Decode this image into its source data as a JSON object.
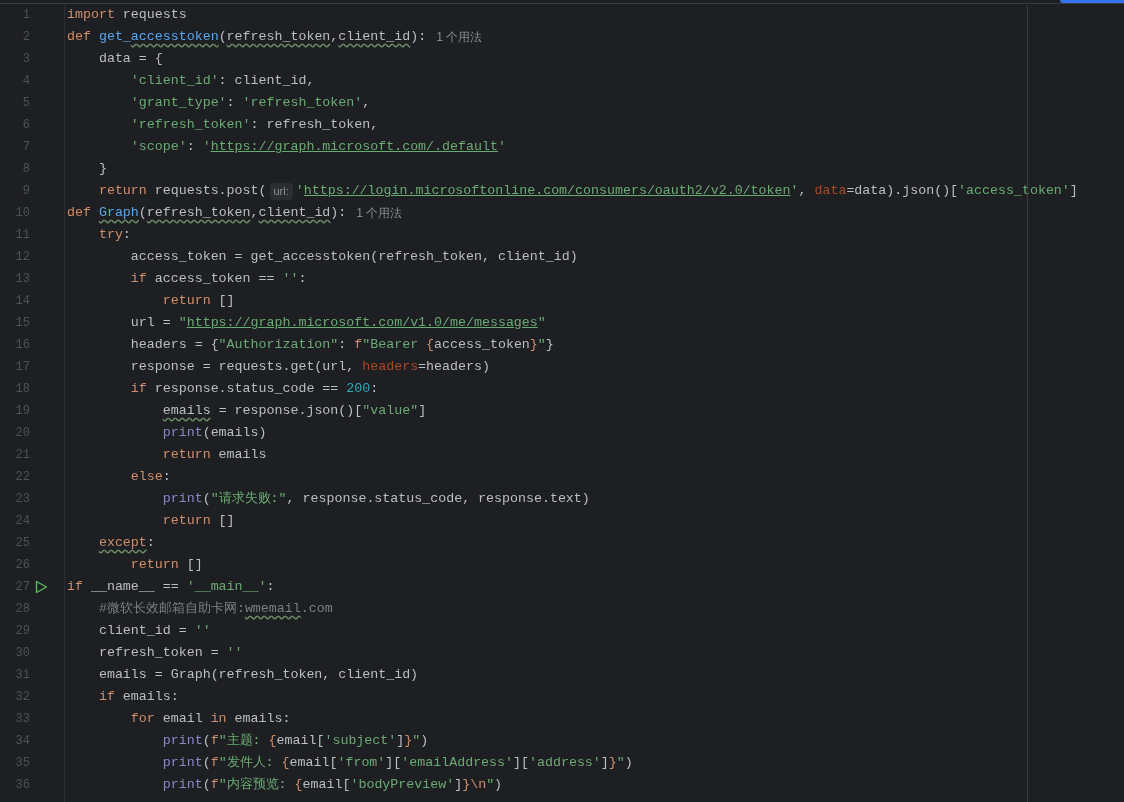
{
  "editor": {
    "lines": [
      {
        "number": "1",
        "run_marker": false,
        "tokens": [
          {
            "kind": "keyword",
            "text": "import"
          },
          {
            "kind": "plain",
            "text": " requests"
          }
        ]
      },
      {
        "number": "2",
        "run_marker": false,
        "tokens": [
          {
            "kind": "keyword",
            "text": "def "
          },
          {
            "kind": "function",
            "text": "get_"
          },
          {
            "kind": "function",
            "text": "accesstoken",
            "squiggle": true
          },
          {
            "kind": "plain",
            "text": "("
          },
          {
            "kind": "plain",
            "text": "refresh_token",
            "squiggle": true
          },
          {
            "kind": "plain",
            "text": ","
          },
          {
            "kind": "plain",
            "text": "client_id",
            "squiggle": true
          },
          {
            "kind": "plain",
            "text": "):"
          },
          {
            "kind": "usages",
            "text": "1 个用法"
          }
        ]
      },
      {
        "number": "3",
        "run_marker": false,
        "tokens": [
          {
            "kind": "plain",
            "text": "    data = {"
          }
        ]
      },
      {
        "number": "4",
        "run_marker": false,
        "tokens": [
          {
            "kind": "string",
            "text": "        'client_id'"
          },
          {
            "kind": "plain",
            "text": ": client_id,"
          }
        ]
      },
      {
        "number": "5",
        "run_marker": false,
        "tokens": [
          {
            "kind": "string",
            "text": "        'grant_type'"
          },
          {
            "kind": "plain",
            "text": ": "
          },
          {
            "kind": "string",
            "text": "'refresh_token'"
          },
          {
            "kind": "plain",
            "text": ","
          }
        ]
      },
      {
        "number": "6",
        "run_marker": false,
        "tokens": [
          {
            "kind": "string",
            "text": "        'refresh_token'"
          },
          {
            "kind": "plain",
            "text": ": refresh_token,"
          }
        ]
      },
      {
        "number": "7",
        "run_marker": false,
        "tokens": [
          {
            "kind": "string",
            "text": "        'scope'"
          },
          {
            "kind": "plain",
            "text": ": "
          },
          {
            "kind": "string",
            "text": "'"
          },
          {
            "kind": "url",
            "text": "https://graph.microsoft.com/.default"
          },
          {
            "kind": "string",
            "text": "'"
          }
        ]
      },
      {
        "number": "8",
        "run_marker": false,
        "tokens": [
          {
            "kind": "plain",
            "text": "    }"
          }
        ]
      },
      {
        "number": "9",
        "run_marker": false,
        "tokens": [
          {
            "kind": "keyword",
            "text": "    return"
          },
          {
            "kind": "plain",
            "text": " requests.post("
          },
          {
            "kind": "hint",
            "text": "url:"
          },
          {
            "kind": "string",
            "text": "'"
          },
          {
            "kind": "url",
            "text": "https://login.microsoftonline.com/consumers/oauth2/v2.0/token"
          },
          {
            "kind": "string",
            "text": "'"
          },
          {
            "kind": "plain",
            "text": ", "
          },
          {
            "kind": "kwarg",
            "text": "data"
          },
          {
            "kind": "plain",
            "text": "=data).json()["
          },
          {
            "kind": "string",
            "text": "'access_token'"
          },
          {
            "kind": "plain",
            "text": "]"
          }
        ]
      },
      {
        "number": "10",
        "run_marker": false,
        "tokens": [
          {
            "kind": "keyword",
            "text": "def "
          },
          {
            "kind": "function",
            "text": "Graph",
            "squiggle": true
          },
          {
            "kind": "plain",
            "text": "("
          },
          {
            "kind": "plain",
            "text": "refresh_token",
            "squiggle": true
          },
          {
            "kind": "plain",
            "text": ","
          },
          {
            "kind": "plain",
            "text": "client_id",
            "squiggle": true
          },
          {
            "kind": "plain",
            "text": "):"
          },
          {
            "kind": "usages",
            "text": "1 个用法"
          }
        ]
      },
      {
        "number": "11",
        "run_marker": false,
        "tokens": [
          {
            "kind": "keyword",
            "text": "    try"
          },
          {
            "kind": "plain",
            "text": ":"
          }
        ]
      },
      {
        "number": "12",
        "run_marker": false,
        "tokens": [
          {
            "kind": "plain",
            "text": "        access_token = get_accesstoken(refresh_token, client_id)"
          }
        ]
      },
      {
        "number": "13",
        "run_marker": false,
        "tokens": [
          {
            "kind": "keyword",
            "text": "        if"
          },
          {
            "kind": "plain",
            "text": " access_token == "
          },
          {
            "kind": "string",
            "text": "''"
          },
          {
            "kind": "plain",
            "text": ":"
          }
        ]
      },
      {
        "number": "14",
        "run_marker": false,
        "tokens": [
          {
            "kind": "keyword",
            "text": "            return"
          },
          {
            "kind": "plain",
            "text": " []"
          }
        ]
      },
      {
        "number": "15",
        "run_marker": false,
        "tokens": [
          {
            "kind": "plain",
            "text": "        url = "
          },
          {
            "kind": "string",
            "text": "\""
          },
          {
            "kind": "url",
            "text": "https://graph.microsoft.com/v1.0/me/messages"
          },
          {
            "kind": "string",
            "text": "\""
          }
        ]
      },
      {
        "number": "16",
        "run_marker": false,
        "tokens": [
          {
            "kind": "plain",
            "text": "        headers = {"
          },
          {
            "kind": "string",
            "text": "\"Authorization\""
          },
          {
            "kind": "plain",
            "text": ": "
          },
          {
            "kind": "format",
            "text": "f"
          },
          {
            "kind": "string",
            "text": "\"Bearer "
          },
          {
            "kind": "format",
            "text": "{"
          },
          {
            "kind": "plain",
            "text": "access_token"
          },
          {
            "kind": "format",
            "text": "}"
          },
          {
            "kind": "string",
            "text": "\""
          },
          {
            "kind": "plain",
            "text": "}"
          }
        ]
      },
      {
        "number": "17",
        "run_marker": false,
        "tokens": [
          {
            "kind": "plain",
            "text": "        response = requests.get(url, "
          },
          {
            "kind": "kwarg",
            "text": "headers"
          },
          {
            "kind": "plain",
            "text": "=headers)"
          }
        ]
      },
      {
        "number": "18",
        "run_marker": false,
        "tokens": [
          {
            "kind": "keyword",
            "text": "        if"
          },
          {
            "kind": "plain",
            "text": " response.status_code == "
          },
          {
            "kind": "number",
            "text": "200"
          },
          {
            "kind": "plain",
            "text": ":"
          }
        ]
      },
      {
        "number": "19",
        "run_marker": false,
        "tokens": [
          {
            "kind": "plain",
            "text": "            emails",
            "squiggle": true
          },
          {
            "kind": "plain",
            "text": " = response.json()["
          },
          {
            "kind": "string",
            "text": "\"value\""
          },
          {
            "kind": "plain",
            "text": "]"
          }
        ]
      },
      {
        "number": "20",
        "run_marker": false,
        "tokens": [
          {
            "kind": "builtin",
            "text": "            print"
          },
          {
            "kind": "plain",
            "text": "(emails)"
          }
        ]
      },
      {
        "number": "21",
        "run_marker": false,
        "tokens": [
          {
            "kind": "keyword",
            "text": "            return"
          },
          {
            "kind": "plain",
            "text": " emails"
          }
        ]
      },
      {
        "number": "22",
        "run_marker": false,
        "tokens": [
          {
            "kind": "keyword",
            "text": "        else"
          },
          {
            "kind": "plain",
            "text": ":"
          }
        ]
      },
      {
        "number": "23",
        "run_marker": false,
        "tokens": [
          {
            "kind": "builtin",
            "text": "            print"
          },
          {
            "kind": "plain",
            "text": "("
          },
          {
            "kind": "string",
            "text": "\"请求失败:\""
          },
          {
            "kind": "plain",
            "text": ", response.status_code, response.text)"
          }
        ]
      },
      {
        "number": "24",
        "run_marker": false,
        "tokens": [
          {
            "kind": "keyword",
            "text": "            return"
          },
          {
            "kind": "plain",
            "text": " []"
          }
        ]
      },
      {
        "number": "25",
        "run_marker": false,
        "tokens": [
          {
            "kind": "keyword",
            "text": "    except",
            "squiggle": true
          },
          {
            "kind": "plain",
            "text": ":"
          }
        ]
      },
      {
        "number": "26",
        "run_marker": false,
        "tokens": [
          {
            "kind": "keyword",
            "text": "        return"
          },
          {
            "kind": "plain",
            "text": " []"
          }
        ]
      },
      {
        "number": "27",
        "run_marker": true,
        "tokens": [
          {
            "kind": "keyword",
            "text": "if"
          },
          {
            "kind": "plain",
            "text": " __name__ == "
          },
          {
            "kind": "string",
            "text": "'__main__'"
          },
          {
            "kind": "plain",
            "text": ":"
          }
        ]
      },
      {
        "number": "28",
        "run_marker": false,
        "tokens": [
          {
            "kind": "comment",
            "text": "    #微软长效邮箱自助卡网:"
          },
          {
            "kind": "comment",
            "text": "wmemail",
            "squiggle": true
          },
          {
            "kind": "comment",
            "text": ".com"
          }
        ]
      },
      {
        "number": "29",
        "run_marker": false,
        "tokens": [
          {
            "kind": "plain",
            "text": "    client_id = "
          },
          {
            "kind": "string",
            "text": "''"
          }
        ]
      },
      {
        "number": "30",
        "run_marker": false,
        "tokens": [
          {
            "kind": "plain",
            "text": "    refresh_token = "
          },
          {
            "kind": "string",
            "text": "''"
          }
        ]
      },
      {
        "number": "31",
        "run_marker": false,
        "tokens": [
          {
            "kind": "plain",
            "text": "    emails = Graph(refresh_token, client_id)"
          }
        ]
      },
      {
        "number": "32",
        "run_marker": false,
        "tokens": [
          {
            "kind": "keyword",
            "text": "    if"
          },
          {
            "kind": "plain",
            "text": " emails:"
          }
        ]
      },
      {
        "number": "33",
        "run_marker": false,
        "tokens": [
          {
            "kind": "keyword",
            "text": "        for"
          },
          {
            "kind": "plain",
            "text": " email "
          },
          {
            "kind": "keyword",
            "text": "in"
          },
          {
            "kind": "plain",
            "text": " emails:"
          }
        ]
      },
      {
        "number": "34",
        "run_marker": false,
        "tokens": [
          {
            "kind": "builtin",
            "text": "            print"
          },
          {
            "kind": "plain",
            "text": "("
          },
          {
            "kind": "format",
            "text": "f"
          },
          {
            "kind": "string",
            "text": "\"主题: "
          },
          {
            "kind": "format",
            "text": "{"
          },
          {
            "kind": "plain",
            "text": "email["
          },
          {
            "kind": "string",
            "text": "'subject'"
          },
          {
            "kind": "plain",
            "text": "]"
          },
          {
            "kind": "format",
            "text": "}"
          },
          {
            "kind": "string",
            "text": "\""
          },
          {
            "kind": "plain",
            "text": ")"
          }
        ]
      },
      {
        "number": "35",
        "run_marker": false,
        "tokens": [
          {
            "kind": "builtin",
            "text": "            print"
          },
          {
            "kind": "plain",
            "text": "("
          },
          {
            "kind": "format",
            "text": "f"
          },
          {
            "kind": "string",
            "text": "\"发件人: "
          },
          {
            "kind": "format",
            "text": "{"
          },
          {
            "kind": "plain",
            "text": "email["
          },
          {
            "kind": "string",
            "text": "'from'"
          },
          {
            "kind": "plain",
            "text": "]["
          },
          {
            "kind": "string",
            "text": "'emailAddress'"
          },
          {
            "kind": "plain",
            "text": "]["
          },
          {
            "kind": "string",
            "text": "'address'"
          },
          {
            "kind": "plain",
            "text": "]"
          },
          {
            "kind": "format",
            "text": "}"
          },
          {
            "kind": "string",
            "text": "\""
          },
          {
            "kind": "plain",
            "text": ")"
          }
        ]
      },
      {
        "number": "36",
        "run_marker": false,
        "tokens": [
          {
            "kind": "builtin",
            "text": "            print"
          },
          {
            "kind": "plain",
            "text": "("
          },
          {
            "kind": "format",
            "text": "f"
          },
          {
            "kind": "string",
            "text": "\"内容预览: "
          },
          {
            "kind": "format",
            "text": "{"
          },
          {
            "kind": "plain",
            "text": "email["
          },
          {
            "kind": "string",
            "text": "'bodyPreview'"
          },
          {
            "kind": "plain",
            "text": "]"
          },
          {
            "kind": "format",
            "text": "}\\n"
          },
          {
            "kind": "string",
            "text": "\""
          },
          {
            "kind": "plain",
            "text": ")"
          }
        ]
      }
    ]
  }
}
